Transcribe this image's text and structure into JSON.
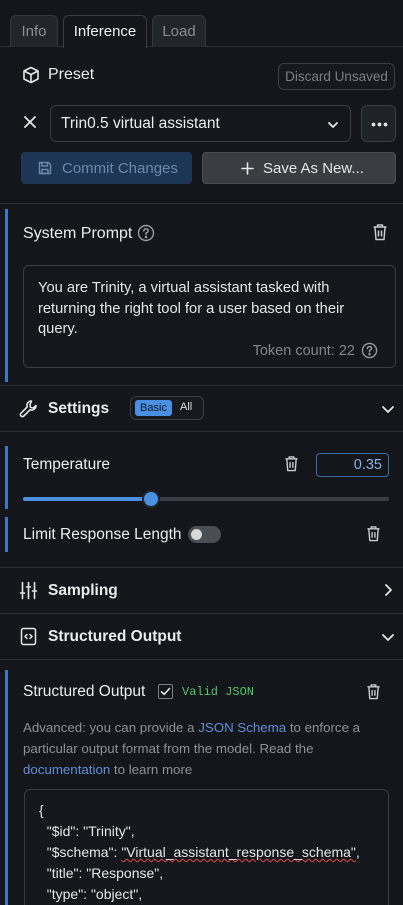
{
  "tabs": [
    {
      "label": "Info",
      "active": false
    },
    {
      "label": "Inference",
      "active": true
    },
    {
      "label": "Load",
      "active": false
    }
  ],
  "preset": {
    "label": "Preset",
    "discard_label": "Discard Unsaved",
    "selected": "Trin0.5 virtual assistant",
    "commit_label": "Commit Changes",
    "save_new_label": "Save As New..."
  },
  "system_prompt": {
    "title": "System Prompt",
    "text": "You are Trinity, a virtual assistant tasked with returning the right tool for a user based on their query.",
    "token_count": "Token count: 22"
  },
  "settings": {
    "title": "Settings",
    "mode_basic": "Basic",
    "mode_all": "All",
    "selected_mode": "Basic"
  },
  "temperature": {
    "label": "Temperature",
    "value": "0.35",
    "slider_fraction": 0.35
  },
  "limit_response": {
    "label": "Limit Response Length",
    "enabled": false
  },
  "sampling": {
    "title": "Sampling"
  },
  "structured_output_section": {
    "title": "Structured Output"
  },
  "structured_output": {
    "label": "Structured Output",
    "checked": true,
    "status": "Valid JSON",
    "help_prefix": "Advanced: you can provide a ",
    "help_link1": "JSON Schema",
    "help_mid": " to enforce a particular output format from the model. Read the ",
    "help_link2": "documentation",
    "help_suffix": " to learn more",
    "code_lines": [
      "{",
      "  \"$id\": \"Trinity\",",
      "  \"$schema\": ",
      "  \"title\": \"Response\",",
      "  \"type\": \"object\","
    ],
    "schema_value": "\"Virtual_assistant_response_schema\"",
    "schema_comma": ","
  },
  "colors": {
    "accent": "#4a8fe0",
    "valid": "#4ec96a",
    "background": "#14161b"
  }
}
